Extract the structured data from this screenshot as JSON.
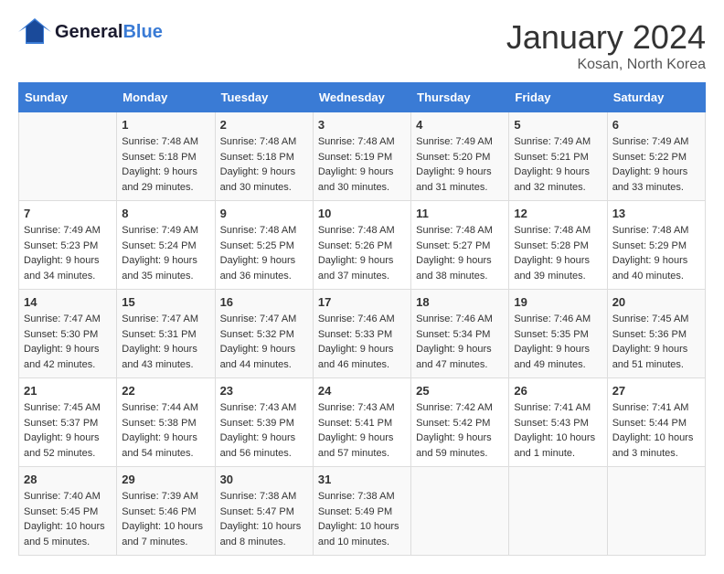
{
  "header": {
    "logo_general": "General",
    "logo_blue": "Blue",
    "month_title": "January 2024",
    "subtitle": "Kosan, North Korea"
  },
  "days_of_week": [
    "Sunday",
    "Monday",
    "Tuesday",
    "Wednesday",
    "Thursday",
    "Friday",
    "Saturday"
  ],
  "weeks": [
    [
      {
        "day": "",
        "sunrise": "",
        "sunset": "",
        "daylight": ""
      },
      {
        "day": "1",
        "sunrise": "Sunrise: 7:48 AM",
        "sunset": "Sunset: 5:18 PM",
        "daylight": "Daylight: 9 hours and 29 minutes."
      },
      {
        "day": "2",
        "sunrise": "Sunrise: 7:48 AM",
        "sunset": "Sunset: 5:18 PM",
        "daylight": "Daylight: 9 hours and 30 minutes."
      },
      {
        "day": "3",
        "sunrise": "Sunrise: 7:48 AM",
        "sunset": "Sunset: 5:19 PM",
        "daylight": "Daylight: 9 hours and 30 minutes."
      },
      {
        "day": "4",
        "sunrise": "Sunrise: 7:49 AM",
        "sunset": "Sunset: 5:20 PM",
        "daylight": "Daylight: 9 hours and 31 minutes."
      },
      {
        "day": "5",
        "sunrise": "Sunrise: 7:49 AM",
        "sunset": "Sunset: 5:21 PM",
        "daylight": "Daylight: 9 hours and 32 minutes."
      },
      {
        "day": "6",
        "sunrise": "Sunrise: 7:49 AM",
        "sunset": "Sunset: 5:22 PM",
        "daylight": "Daylight: 9 hours and 33 minutes."
      }
    ],
    [
      {
        "day": "7",
        "sunrise": "Sunrise: 7:49 AM",
        "sunset": "Sunset: 5:23 PM",
        "daylight": "Daylight: 9 hours and 34 minutes."
      },
      {
        "day": "8",
        "sunrise": "Sunrise: 7:49 AM",
        "sunset": "Sunset: 5:24 PM",
        "daylight": "Daylight: 9 hours and 35 minutes."
      },
      {
        "day": "9",
        "sunrise": "Sunrise: 7:48 AM",
        "sunset": "Sunset: 5:25 PM",
        "daylight": "Daylight: 9 hours and 36 minutes."
      },
      {
        "day": "10",
        "sunrise": "Sunrise: 7:48 AM",
        "sunset": "Sunset: 5:26 PM",
        "daylight": "Daylight: 9 hours and 37 minutes."
      },
      {
        "day": "11",
        "sunrise": "Sunrise: 7:48 AM",
        "sunset": "Sunset: 5:27 PM",
        "daylight": "Daylight: 9 hours and 38 minutes."
      },
      {
        "day": "12",
        "sunrise": "Sunrise: 7:48 AM",
        "sunset": "Sunset: 5:28 PM",
        "daylight": "Daylight: 9 hours and 39 minutes."
      },
      {
        "day": "13",
        "sunrise": "Sunrise: 7:48 AM",
        "sunset": "Sunset: 5:29 PM",
        "daylight": "Daylight: 9 hours and 40 minutes."
      }
    ],
    [
      {
        "day": "14",
        "sunrise": "Sunrise: 7:47 AM",
        "sunset": "Sunset: 5:30 PM",
        "daylight": "Daylight: 9 hours and 42 minutes."
      },
      {
        "day": "15",
        "sunrise": "Sunrise: 7:47 AM",
        "sunset": "Sunset: 5:31 PM",
        "daylight": "Daylight: 9 hours and 43 minutes."
      },
      {
        "day": "16",
        "sunrise": "Sunrise: 7:47 AM",
        "sunset": "Sunset: 5:32 PM",
        "daylight": "Daylight: 9 hours and 44 minutes."
      },
      {
        "day": "17",
        "sunrise": "Sunrise: 7:46 AM",
        "sunset": "Sunset: 5:33 PM",
        "daylight": "Daylight: 9 hours and 46 minutes."
      },
      {
        "day": "18",
        "sunrise": "Sunrise: 7:46 AM",
        "sunset": "Sunset: 5:34 PM",
        "daylight": "Daylight: 9 hours and 47 minutes."
      },
      {
        "day": "19",
        "sunrise": "Sunrise: 7:46 AM",
        "sunset": "Sunset: 5:35 PM",
        "daylight": "Daylight: 9 hours and 49 minutes."
      },
      {
        "day": "20",
        "sunrise": "Sunrise: 7:45 AM",
        "sunset": "Sunset: 5:36 PM",
        "daylight": "Daylight: 9 hours and 51 minutes."
      }
    ],
    [
      {
        "day": "21",
        "sunrise": "Sunrise: 7:45 AM",
        "sunset": "Sunset: 5:37 PM",
        "daylight": "Daylight: 9 hours and 52 minutes."
      },
      {
        "day": "22",
        "sunrise": "Sunrise: 7:44 AM",
        "sunset": "Sunset: 5:38 PM",
        "daylight": "Daylight: 9 hours and 54 minutes."
      },
      {
        "day": "23",
        "sunrise": "Sunrise: 7:43 AM",
        "sunset": "Sunset: 5:39 PM",
        "daylight": "Daylight: 9 hours and 56 minutes."
      },
      {
        "day": "24",
        "sunrise": "Sunrise: 7:43 AM",
        "sunset": "Sunset: 5:41 PM",
        "daylight": "Daylight: 9 hours and 57 minutes."
      },
      {
        "day": "25",
        "sunrise": "Sunrise: 7:42 AM",
        "sunset": "Sunset: 5:42 PM",
        "daylight": "Daylight: 9 hours and 59 minutes."
      },
      {
        "day": "26",
        "sunrise": "Sunrise: 7:41 AM",
        "sunset": "Sunset: 5:43 PM",
        "daylight": "Daylight: 10 hours and 1 minute."
      },
      {
        "day": "27",
        "sunrise": "Sunrise: 7:41 AM",
        "sunset": "Sunset: 5:44 PM",
        "daylight": "Daylight: 10 hours and 3 minutes."
      }
    ],
    [
      {
        "day": "28",
        "sunrise": "Sunrise: 7:40 AM",
        "sunset": "Sunset: 5:45 PM",
        "daylight": "Daylight: 10 hours and 5 minutes."
      },
      {
        "day": "29",
        "sunrise": "Sunrise: 7:39 AM",
        "sunset": "Sunset: 5:46 PM",
        "daylight": "Daylight: 10 hours and 7 minutes."
      },
      {
        "day": "30",
        "sunrise": "Sunrise: 7:38 AM",
        "sunset": "Sunset: 5:47 PM",
        "daylight": "Daylight: 10 hours and 8 minutes."
      },
      {
        "day": "31",
        "sunrise": "Sunrise: 7:38 AM",
        "sunset": "Sunset: 5:49 PM",
        "daylight": "Daylight: 10 hours and 10 minutes."
      },
      {
        "day": "",
        "sunrise": "",
        "sunset": "",
        "daylight": ""
      },
      {
        "day": "",
        "sunrise": "",
        "sunset": "",
        "daylight": ""
      },
      {
        "day": "",
        "sunrise": "",
        "sunset": "",
        "daylight": ""
      }
    ]
  ]
}
